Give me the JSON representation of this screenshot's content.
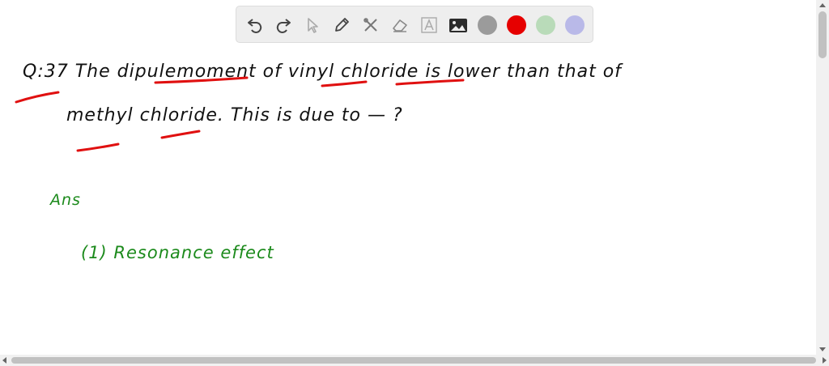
{
  "toolbar": {
    "tools": [
      {
        "name": "undo-icon"
      },
      {
        "name": "redo-icon"
      },
      {
        "name": "select-pointer-icon"
      },
      {
        "name": "pen-icon"
      },
      {
        "name": "tools-icon"
      },
      {
        "name": "eraser-icon"
      },
      {
        "name": "text-icon"
      },
      {
        "name": "image-icon"
      }
    ],
    "colors": [
      "#9b9b9b",
      "#e60000",
      "#b9dbb9",
      "#b9b9e8"
    ]
  },
  "notes": {
    "question_line1": "Q:37  The  dipulemoment  of  vinyl  chloride  is  lower  than  that  of",
    "question_line2": "methyl  chloride.  This  is  due  to  —  ?",
    "answer_label": "Ans",
    "option1": "(1)  Resonance   effect"
  }
}
